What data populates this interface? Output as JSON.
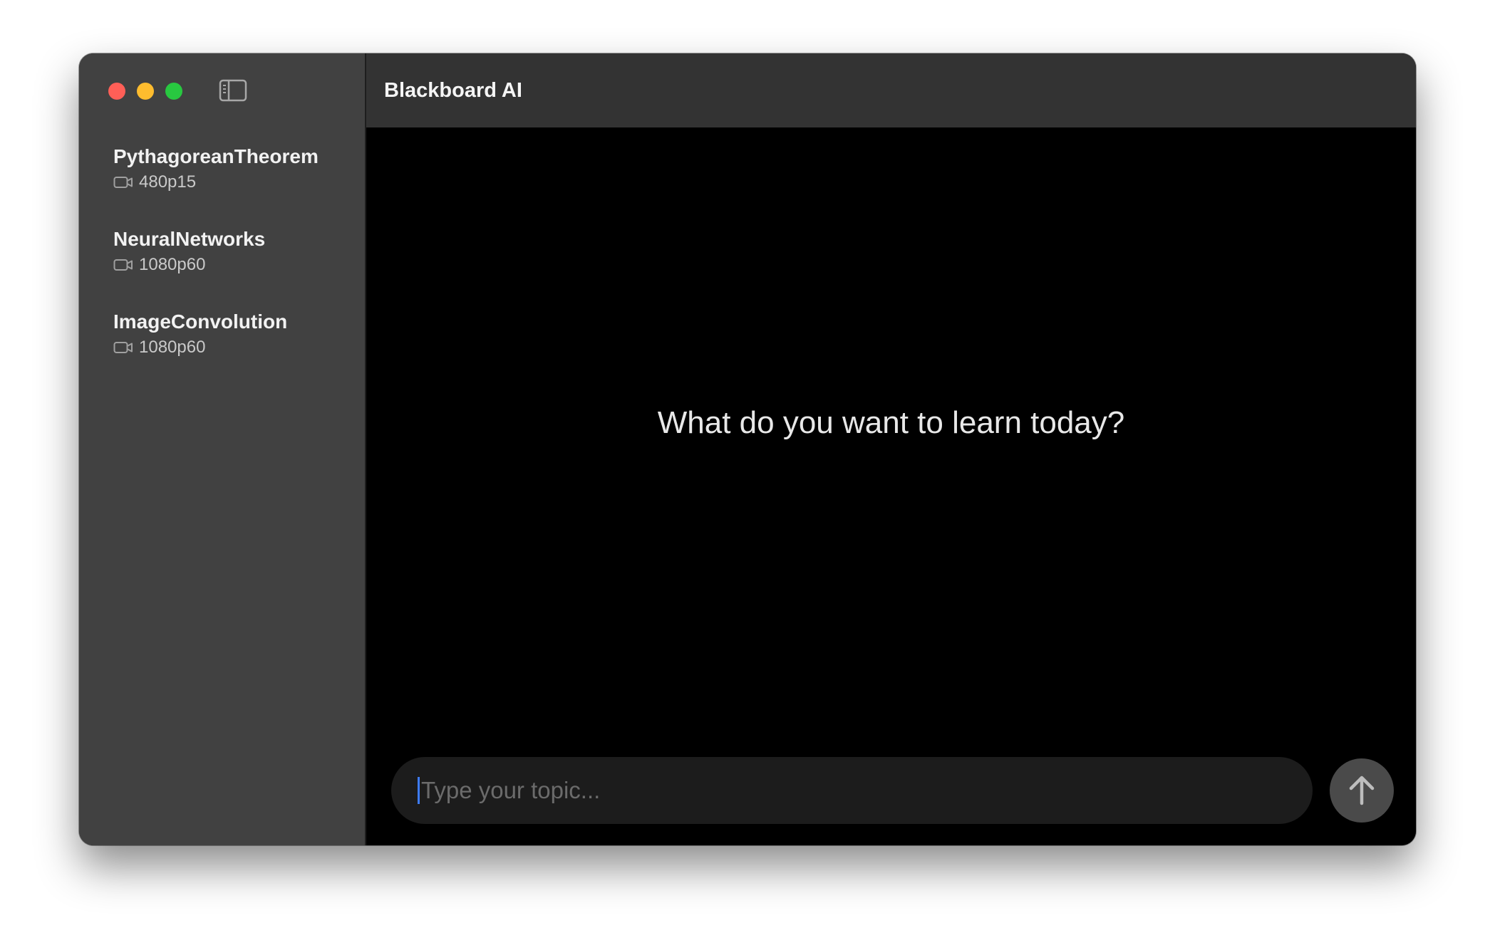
{
  "header": {
    "title": "Blackboard AI"
  },
  "sidebar": {
    "items": [
      {
        "title": "PythagoreanTheorem",
        "quality": "480p15",
        "icon": "video-camera-icon"
      },
      {
        "title": "NeuralNetworks",
        "quality": "1080p60",
        "icon": "video-camera-icon"
      },
      {
        "title": "ImageConvolution",
        "quality": "1080p60",
        "icon": "video-camera-icon"
      }
    ]
  },
  "main": {
    "prompt": "What do you want to learn today?",
    "input": {
      "placeholder": "Type your topic...",
      "value": ""
    },
    "send_icon": "arrow-up-icon"
  },
  "colors": {
    "sidebar_bg": "#414141",
    "header_bg": "#333333",
    "main_bg": "#000000",
    "input_bg": "#1c1c1c",
    "send_button_bg": "#4a4a4a",
    "caret": "#3d7bf5"
  }
}
